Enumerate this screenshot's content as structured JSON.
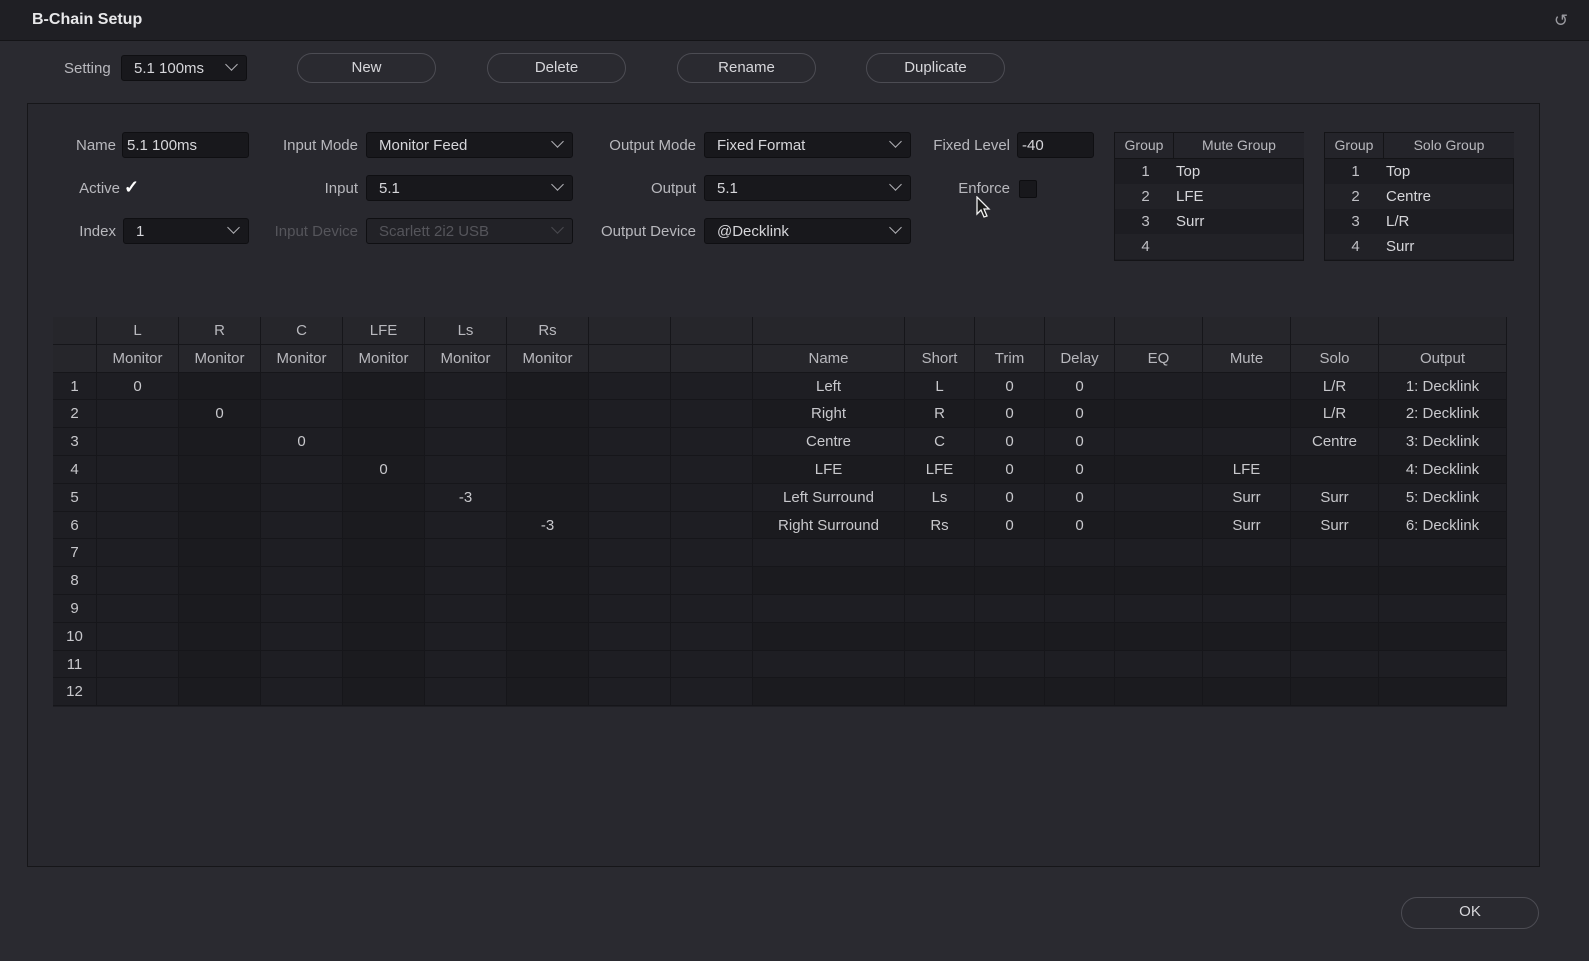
{
  "window": {
    "title": "B-Chain Setup",
    "reset_icon": "reset-icon"
  },
  "toolbar": {
    "setting_label": "Setting",
    "setting_value": "5.1 100ms",
    "new_label": "New",
    "delete_label": "Delete",
    "rename_label": "Rename",
    "duplicate_label": "Duplicate"
  },
  "form": {
    "name_label": "Name",
    "name_value": "5.1 100ms",
    "active_label": "Active",
    "active_checked": true,
    "index_label": "Index",
    "index_value": "1",
    "input_mode_label": "Input Mode",
    "input_mode_value": "Monitor Feed",
    "input_label": "Input",
    "input_value": "5.1",
    "input_device_label": "Input Device",
    "input_device_value": "Scarlett 2i2 USB",
    "output_mode_label": "Output Mode",
    "output_mode_value": "Fixed Format",
    "output_label": "Output",
    "output_value": "5.1",
    "output_device_label": "Output Device",
    "output_device_value": "@Decklink",
    "fixed_level_label": "Fixed Level",
    "fixed_level_value": "-40",
    "enforce_label": "Enforce",
    "enforce_checked": false
  },
  "mute_groups": {
    "headers": [
      "Group",
      "Mute Group"
    ],
    "rows": [
      {
        "num": "1",
        "name": "Top"
      },
      {
        "num": "2",
        "name": "LFE"
      },
      {
        "num": "3",
        "name": "Surr"
      },
      {
        "num": "4",
        "name": ""
      }
    ]
  },
  "solo_groups": {
    "headers": [
      "Group",
      "Solo Group"
    ],
    "rows": [
      {
        "num": "1",
        "name": "Top"
      },
      {
        "num": "2",
        "name": "Centre"
      },
      {
        "num": "3",
        "name": "L/R"
      },
      {
        "num": "4",
        "name": "Surr"
      }
    ]
  },
  "matrix": {
    "input_channels": [
      "L",
      "R",
      "C",
      "LFE",
      "Ls",
      "Rs"
    ],
    "input_sources": [
      "Monitor",
      "Monitor",
      "Monitor",
      "Monitor",
      "Monitor",
      "Monitor"
    ],
    "row_numbers": [
      "1",
      "2",
      "3",
      "4",
      "5",
      "6",
      "7",
      "8",
      "9",
      "10",
      "11",
      "12"
    ],
    "values": [
      [
        "0",
        "",
        "",
        "",
        "",
        ""
      ],
      [
        "",
        "0",
        "",
        "",
        "",
        ""
      ],
      [
        "",
        "",
        "0",
        "",
        "",
        ""
      ],
      [
        "",
        "",
        "",
        "0",
        "",
        ""
      ],
      [
        "",
        "",
        "",
        "",
        "-3",
        ""
      ],
      [
        "",
        "",
        "",
        "",
        "",
        "-3"
      ],
      [
        "",
        "",
        "",
        "",
        "",
        ""
      ],
      [
        "",
        "",
        "",
        "",
        "",
        ""
      ],
      [
        "",
        "",
        "",
        "",
        "",
        ""
      ],
      [
        "",
        "",
        "",
        "",
        "",
        ""
      ],
      [
        "",
        "",
        "",
        "",
        "",
        ""
      ],
      [
        "",
        "",
        "",
        "",
        "",
        ""
      ]
    ]
  },
  "outputs": {
    "headers": [
      "Name",
      "Short",
      "Trim",
      "Delay",
      "EQ",
      "Mute",
      "Solo",
      "Output"
    ],
    "rows": [
      [
        "Left",
        "L",
        "0",
        "0",
        "",
        "",
        "L/R",
        "1: Decklink"
      ],
      [
        "Right",
        "R",
        "0",
        "0",
        "",
        "",
        "L/R",
        "2: Decklink"
      ],
      [
        "Centre",
        "C",
        "0",
        "0",
        "",
        "",
        "Centre",
        "3: Decklink"
      ],
      [
        "LFE",
        "LFE",
        "0",
        "0",
        "",
        "LFE",
        "",
        "4: Decklink"
      ],
      [
        "Left Surround",
        "Ls",
        "0",
        "0",
        "",
        "Surr",
        "Surr",
        "5: Decklink"
      ],
      [
        "Right Surround",
        "Rs",
        "0",
        "0",
        "",
        "Surr",
        "Surr",
        "6: Decklink"
      ],
      [
        "",
        "",
        "",
        "",
        "",
        "",
        "",
        ""
      ],
      [
        "",
        "",
        "",
        "",
        "",
        "",
        "",
        ""
      ],
      [
        "",
        "",
        "",
        "",
        "",
        "",
        "",
        ""
      ],
      [
        "",
        "",
        "",
        "",
        "",
        "",
        "",
        ""
      ],
      [
        "",
        "",
        "",
        "",
        "",
        "",
        "",
        ""
      ],
      [
        "",
        "",
        "",
        "",
        "",
        "",
        "",
        ""
      ]
    ]
  },
  "footer": {
    "ok_label": "OK"
  }
}
